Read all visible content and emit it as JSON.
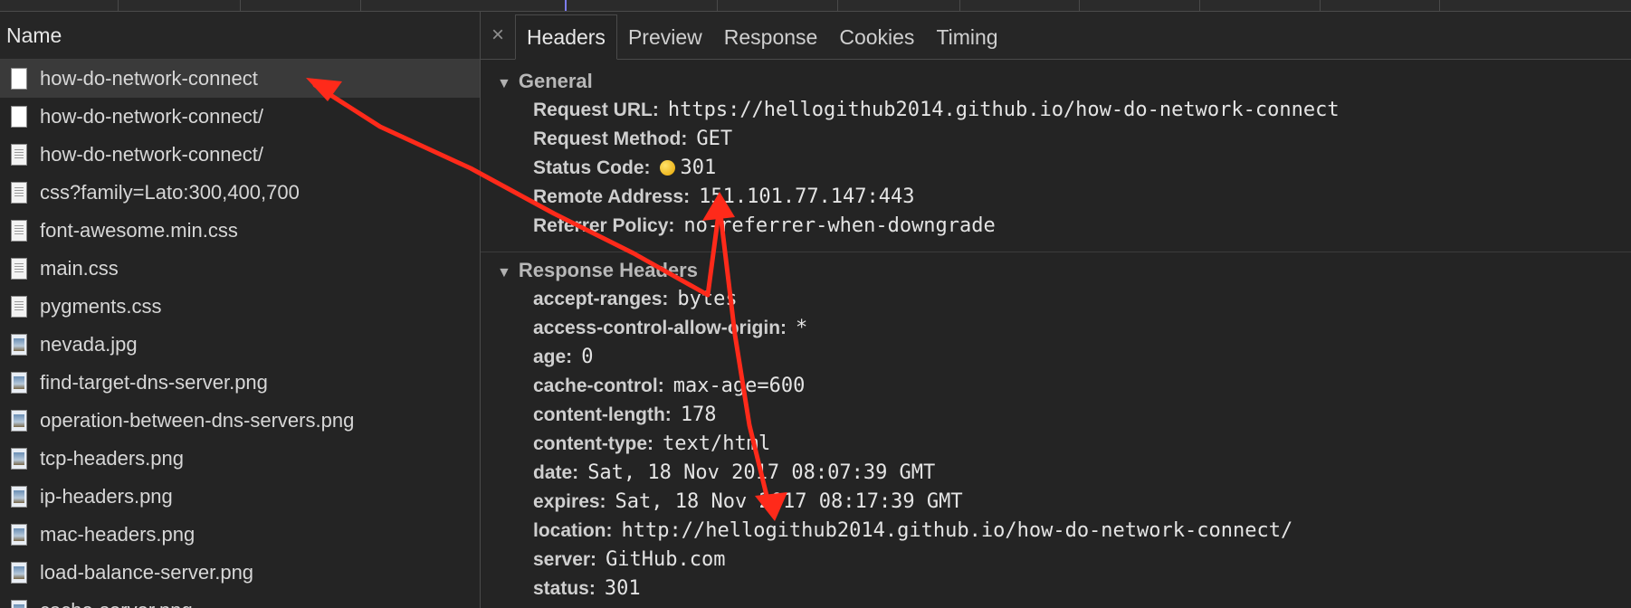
{
  "left": {
    "header": "Name",
    "requests": [
      {
        "name": "how-do-network-connect",
        "icon": "document-icon",
        "selected": true
      },
      {
        "name": "how-do-network-connect/",
        "icon": "document-icon"
      },
      {
        "name": "how-do-network-connect/",
        "icon": "document-icon"
      },
      {
        "name": "css?family=Lato:300,400,700",
        "icon": "stylesheet-icon"
      },
      {
        "name": "font-awesome.min.css",
        "icon": "stylesheet-icon"
      },
      {
        "name": "main.css",
        "icon": "stylesheet-icon"
      },
      {
        "name": "pygments.css",
        "icon": "stylesheet-icon"
      },
      {
        "name": "nevada.jpg",
        "icon": "image-icon"
      },
      {
        "name": "find-target-dns-server.png",
        "icon": "image-icon"
      },
      {
        "name": "operation-between-dns-servers.png",
        "icon": "image-icon"
      },
      {
        "name": "tcp-headers.png",
        "icon": "image-icon"
      },
      {
        "name": "ip-headers.png",
        "icon": "image-icon"
      },
      {
        "name": "mac-headers.png",
        "icon": "image-icon"
      },
      {
        "name": "load-balance-server.png",
        "icon": "image-icon"
      },
      {
        "name": "cache-server.png",
        "icon": "image-icon"
      }
    ]
  },
  "tabs": {
    "close": "×",
    "items": [
      "Headers",
      "Preview",
      "Response",
      "Cookies",
      "Timing"
    ],
    "active": "Headers"
  },
  "general": {
    "title": "General",
    "request_url_label": "Request URL:",
    "request_url": "https://hellogithub2014.github.io/how-do-network-connect",
    "request_method_label": "Request Method:",
    "request_method": "GET",
    "status_code_label": "Status Code:",
    "status_code": "301",
    "remote_address_label": "Remote Address:",
    "remote_address": "151.101.77.147:443",
    "referrer_policy_label": "Referrer Policy:",
    "referrer_policy": "no-referrer-when-downgrade"
  },
  "response_headers": {
    "title": "Response Headers",
    "items": [
      {
        "key": "accept-ranges:",
        "value": "bytes"
      },
      {
        "key": "access-control-allow-origin:",
        "value": "*"
      },
      {
        "key": "age:",
        "value": "0"
      },
      {
        "key": "cache-control:",
        "value": "max-age=600"
      },
      {
        "key": "content-length:",
        "value": "178"
      },
      {
        "key": "content-type:",
        "value": "text/html"
      },
      {
        "key": "date:",
        "value": "Sat, 18 Nov 2017 08:07:39 GMT"
      },
      {
        "key": "expires:",
        "value": "Sat, 18 Nov 2017 08:17:39 GMT"
      },
      {
        "key": "location:",
        "value": "http://hellogithub2014.github.io/how-do-network-connect/"
      },
      {
        "key": "server:",
        "value": "GitHub.com"
      },
      {
        "key": "status:",
        "value": "301"
      }
    ]
  },
  "colors": {
    "status_dot": "#f0b400",
    "annotation_arrow": "#ff2a1a"
  }
}
